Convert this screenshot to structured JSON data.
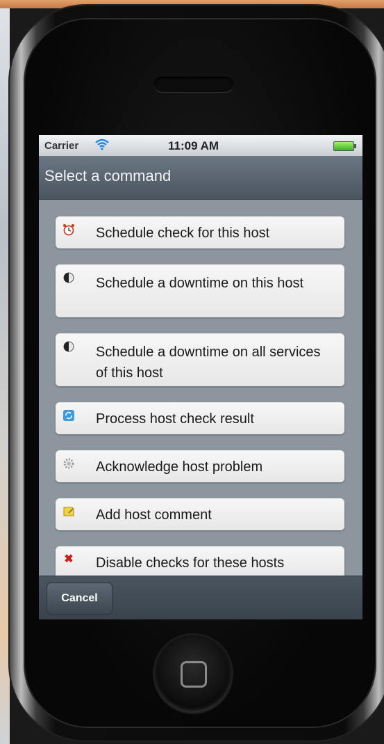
{
  "status_bar": {
    "carrier": "Carrier",
    "time": "11:09 AM"
  },
  "nav": {
    "title": "Select a command"
  },
  "commands": [
    {
      "label": "Schedule check for this host",
      "icon": "alarm-clock-icon"
    },
    {
      "label": "Schedule a downtime on this host",
      "icon": "half-moon-icon"
    },
    {
      "label": "Schedule a downtime on all services of this host",
      "icon": "half-moon-icon"
    },
    {
      "label": "Process host check result",
      "icon": "refresh-icon"
    },
    {
      "label": "Acknowledge host problem",
      "icon": "gear-icon"
    },
    {
      "label": "Add host comment",
      "icon": "note-icon"
    },
    {
      "label": "Disable checks for these hosts",
      "icon": "red-x-icon"
    }
  ],
  "toolbar": {
    "cancel_label": "Cancel"
  }
}
